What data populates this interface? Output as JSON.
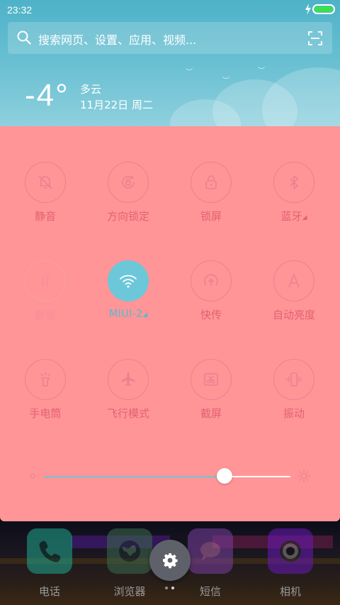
{
  "status_bar": {
    "time": "23:32",
    "battery_color": "#3ce04f"
  },
  "search": {
    "placeholder": "搜索网页、设置、应用、视频...",
    "icon": "search-icon",
    "scan_icon": "scan-icon"
  },
  "weather": {
    "temperature": "-4°",
    "condition": "多云",
    "date": "11月22日 周二"
  },
  "toggles": [
    {
      "label": "静音",
      "icon": "bell-off-icon",
      "active": false
    },
    {
      "label": "方向锁定",
      "icon": "rotation-lock-icon",
      "active": false
    },
    {
      "label": "锁屏",
      "icon": "lock-icon",
      "active": false
    },
    {
      "label": "蓝牙",
      "icon": "bluetooth-icon",
      "active": false,
      "has_more": true
    },
    {
      "label": "数据",
      "icon": "mobile-data-icon",
      "active": false,
      "dimmed": true
    },
    {
      "label": "MIUI-2",
      "icon": "wifi-icon",
      "active": true,
      "has_more": true
    },
    {
      "label": "快传",
      "icon": "fast-transfer-icon",
      "active": false
    },
    {
      "label": "自动亮度",
      "icon": "auto-brightness-icon",
      "active": false
    },
    {
      "label": "手电筒",
      "icon": "flashlight-icon",
      "active": false
    },
    {
      "label": "飞行模式",
      "icon": "airplane-icon",
      "active": false
    },
    {
      "label": "截屏",
      "icon": "screenshot-icon",
      "active": false
    },
    {
      "label": "振动",
      "icon": "vibrate-icon",
      "active": false
    }
  ],
  "brightness": {
    "level_fraction": 0.735
  },
  "dock": {
    "apps": [
      {
        "label": "电话",
        "icon": "phone-icon",
        "color": "#1fa88f"
      },
      {
        "label": "浏览器",
        "icon": "browser-globe-icon",
        "color": "#3d6a4d"
      },
      {
        "label": "短信",
        "icon": "message-icon",
        "color": "#7a3fa0"
      },
      {
        "label": "相机",
        "icon": "camera-icon",
        "color": "#6a19b8"
      }
    ],
    "settings_icon": "settings-gear-icon",
    "page_dots": 2
  },
  "colors": {
    "panel_bg": "#ff9597",
    "accent": "#6cc7d9",
    "icon_stroke": "#ef7f90",
    "label_text": "#e36173"
  }
}
